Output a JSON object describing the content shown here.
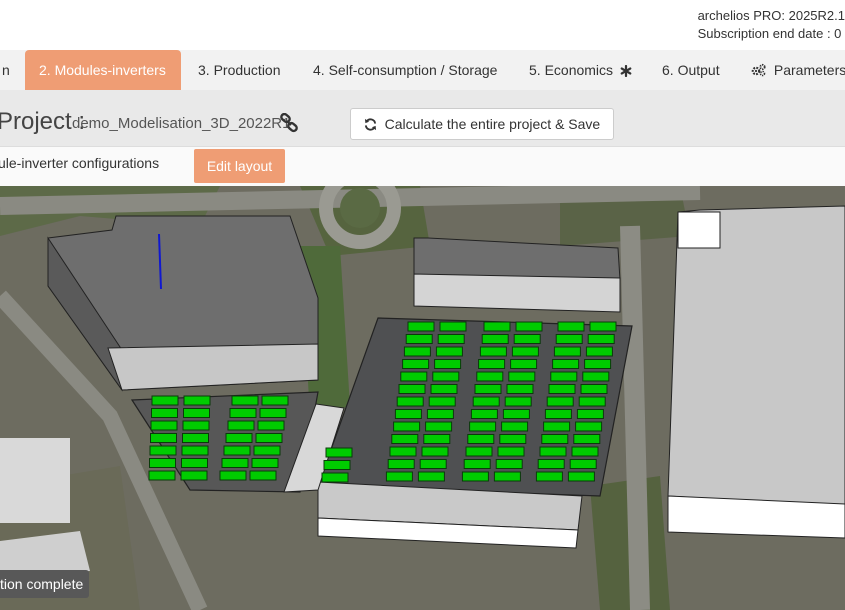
{
  "header": {
    "version_line": "archelios PRO: 2025R2.1",
    "subscription_line": "Subscription end date : 0"
  },
  "tabs": [
    {
      "label": "n"
    },
    {
      "label": "2. Modules-inverters",
      "active": true
    },
    {
      "label": "3. Production"
    },
    {
      "label": "4. Self-consumption / Storage"
    },
    {
      "label": "5. Economics"
    },
    {
      "label": "6. Output"
    },
    {
      "label": "Parameters"
    }
  ],
  "project": {
    "prefix": "Project :",
    "name": "demo_Modelisation_3D_2022R1",
    "calculate_label": "Calculate the entire project & Save"
  },
  "config": {
    "label": "ule-inverter configurations",
    "edit_label": "Edit layout"
  },
  "status": {
    "text": "tion complete"
  },
  "colors": {
    "accent": "#ef9d74",
    "module": "#00cc00",
    "roof": "#6e6e6e"
  },
  "icons": {
    "economics": "asterisk-icon",
    "parameters": "gears-icon",
    "link": "link-icon",
    "refresh": "refresh-icon"
  }
}
